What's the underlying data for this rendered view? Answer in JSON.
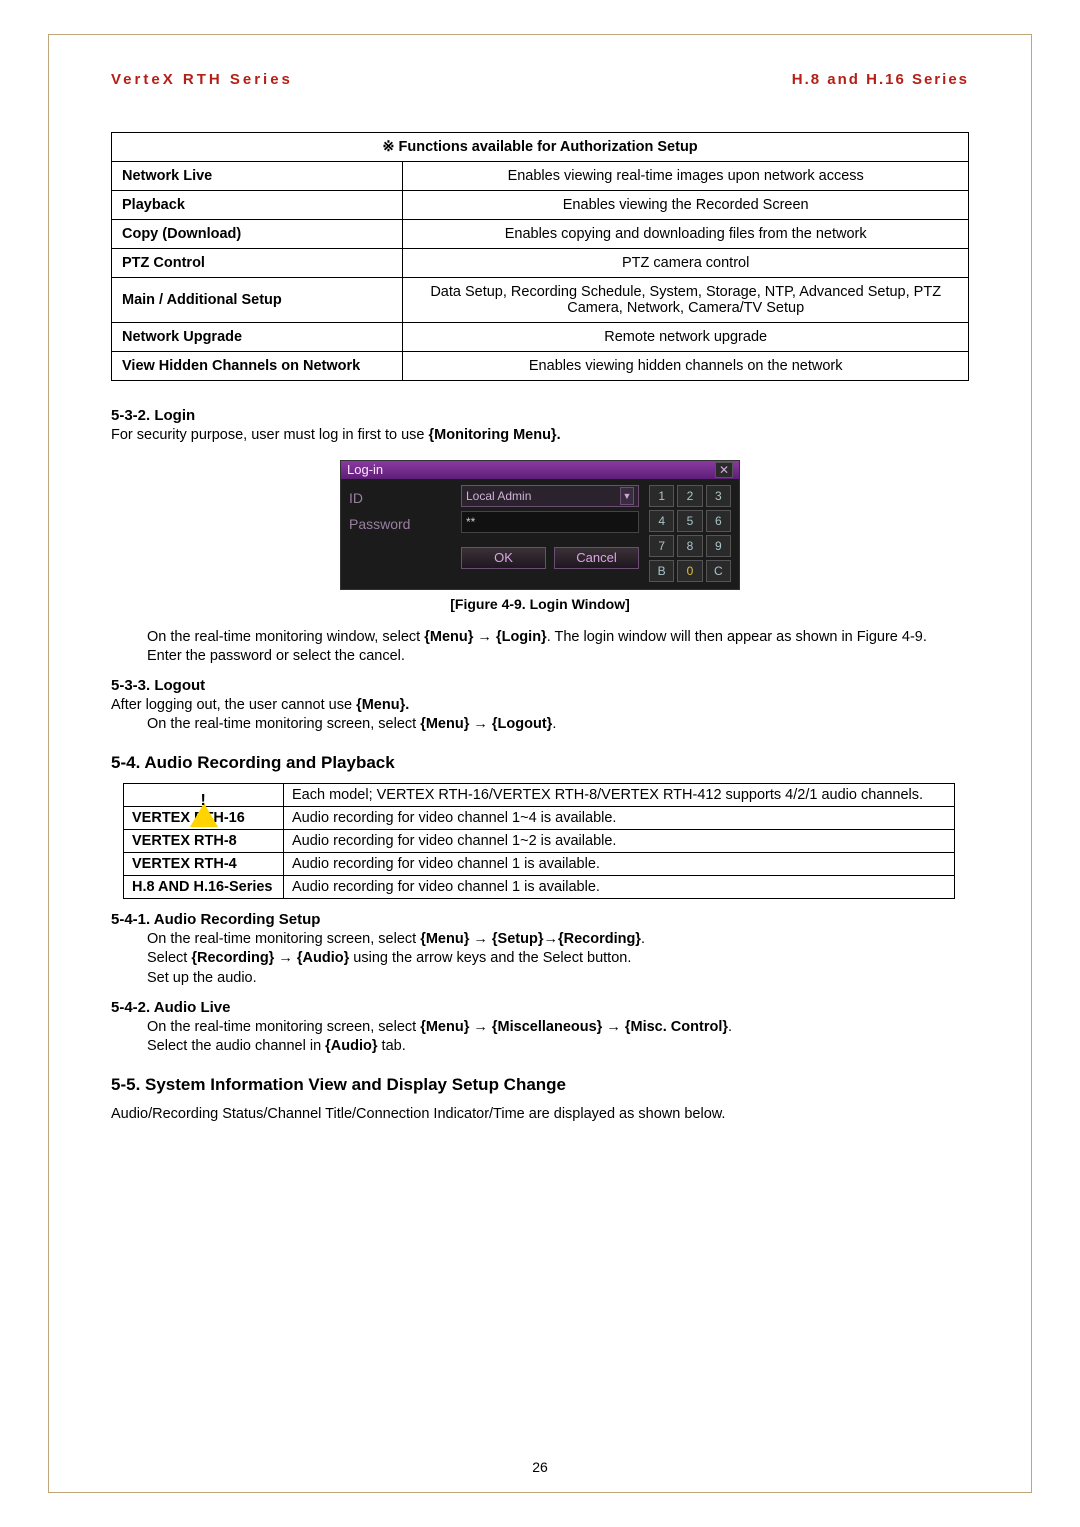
{
  "header": {
    "left": "VerteX RTH Series",
    "right": "H.8 and H.16 Series"
  },
  "auth_table": {
    "title": "※ Functions available for Authorization Setup",
    "rows": [
      {
        "k": "Network Live",
        "v": "Enables viewing real-time images upon network access"
      },
      {
        "k": "Playback",
        "v": "Enables viewing the Recorded Screen"
      },
      {
        "k": "Copy (Download)",
        "v": "Enables copying and downloading files from the network"
      },
      {
        "k": "PTZ Control",
        "v": "PTZ camera control"
      },
      {
        "k": "Main / Additional Setup",
        "v": "Data Setup, Recording Schedule, System, Storage, NTP, Advanced Setup, PTZ Camera, Network, Camera/TV Setup"
      },
      {
        "k": "Network Upgrade",
        "v": "Remote network upgrade"
      },
      {
        "k": "View Hidden Channels on Network",
        "v": "Enables viewing hidden channels on the network"
      }
    ]
  },
  "s532": {
    "h": "5-3-2.  Login",
    "p1a": "For security purpose, user must log in first to use ",
    "p1b": "{Monitoring Menu}.",
    "fig_caption": "[Figure 4-9. Login Window]",
    "step1a": "On the real-time monitoring window, select ",
    "step1b": "{Menu} ",
    "arrow": "→",
    "step1c": " {Login}",
    "step1d": ". The login window will then appear as shown in Figure 4-9.",
    "step2": "Enter the password or select the cancel."
  },
  "login_win": {
    "title": "Log-in",
    "id_label": "ID",
    "pw_label": "Password",
    "id_value": "Local Admin",
    "pw_value": "**",
    "ok": "OK",
    "cancel": "Cancel",
    "keys": [
      "1",
      "2",
      "3",
      "4",
      "5",
      "6",
      "7",
      "8",
      "9",
      "B",
      "0",
      "C"
    ]
  },
  "s533": {
    "h": "5-3-3.  Logout",
    "p1a": "After logging out, the user cannot use ",
    "p1b": "{Menu}.",
    "step1a": "On the real-time monitoring screen, select ",
    "step1b": "{Menu} ",
    "step1c": " {Logout}"
  },
  "s54": {
    "h": "5-4.   Audio Recording and Playback",
    "note": "Each model; VERTEX RTH-16/VERTEX RTH-8/VERTEX RTH-412 supports 4/2/1 audio channels.",
    "rows": [
      {
        "k": "VERTEX RTH-16",
        "v": "Audio recording for video channel 1~4 is available."
      },
      {
        "k": "VERTEX RTH-8",
        "v": "Audio recording for video channel 1~2 is available."
      },
      {
        "k": "VERTEX RTH-4",
        "v": "Audio recording for video channel 1 is available."
      },
      {
        "k": "H.8 AND H.16-Series",
        "v": "Audio recording for video channel 1 is available."
      }
    ]
  },
  "s541": {
    "h": "5-4-1.  Audio Recording Setup",
    "l1a": "On the real-time monitoring screen, select ",
    "l1b": "{Menu} ",
    "l1c": " {Setup}",
    "l1d": "{Recording}",
    "l2a": "Select ",
    "l2b": "{Recording} ",
    "l2c": " {Audio}",
    "l2d": " using the arrow keys and the Select button.",
    "l3": "Set up the audio."
  },
  "s542": {
    "h": "5-4-2.  Audio Live",
    "l1a": "On the real-time monitoring screen, select ",
    "l1b": "{Menu} ",
    "l1c": " {Miscellaneous} ",
    "l1d": " {Misc. Control}",
    "l2a": "Select the audio channel in ",
    "l2b": "{Audio}",
    "l2c": " tab."
  },
  "s55": {
    "h": "5-5.   System Information View and Display Setup Change",
    "p": "Audio/Recording Status/Channel Title/Connection Indicator/Time are displayed as shown below."
  },
  "page_number": "26"
}
